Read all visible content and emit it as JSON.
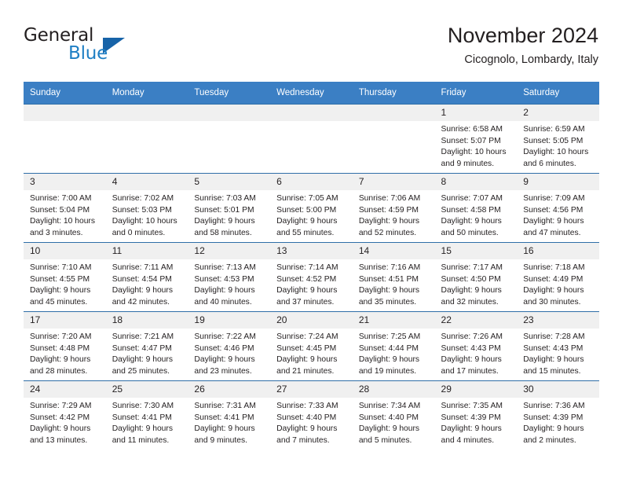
{
  "brand": {
    "name_part1": "General",
    "name_part2": "Blue",
    "triangle_color": "#1763a8",
    "blue_color": "#1f7fc4"
  },
  "header": {
    "month_title": "November 2024",
    "location": "Cicognolo, Lombardy, Italy"
  },
  "theme": {
    "header_bg": "#3b7fc4",
    "daynum_bg": "#f0f0f0",
    "row_border": "#2f6ea8",
    "text": "#231f20"
  },
  "calendar": {
    "weekday_headers": [
      "Sunday",
      "Monday",
      "Tuesday",
      "Wednesday",
      "Thursday",
      "Friday",
      "Saturday"
    ],
    "labels": {
      "sunrise": "Sunrise:",
      "sunset": "Sunset:",
      "daylight": "Daylight:"
    },
    "weeks": [
      [
        {
          "day": "",
          "blank": true
        },
        {
          "day": "",
          "blank": true
        },
        {
          "day": "",
          "blank": true
        },
        {
          "day": "",
          "blank": true
        },
        {
          "day": "",
          "blank": true
        },
        {
          "day": "1",
          "sunrise": "Sunrise: 6:58 AM",
          "sunset": "Sunset: 5:07 PM",
          "daylight_l1": "Daylight: 10 hours",
          "daylight_l2": "and 9 minutes."
        },
        {
          "day": "2",
          "sunrise": "Sunrise: 6:59 AM",
          "sunset": "Sunset: 5:05 PM",
          "daylight_l1": "Daylight: 10 hours",
          "daylight_l2": "and 6 minutes."
        }
      ],
      [
        {
          "day": "3",
          "sunrise": "Sunrise: 7:00 AM",
          "sunset": "Sunset: 5:04 PM",
          "daylight_l1": "Daylight: 10 hours",
          "daylight_l2": "and 3 minutes."
        },
        {
          "day": "4",
          "sunrise": "Sunrise: 7:02 AM",
          "sunset": "Sunset: 5:03 PM",
          "daylight_l1": "Daylight: 10 hours",
          "daylight_l2": "and 0 minutes."
        },
        {
          "day": "5",
          "sunrise": "Sunrise: 7:03 AM",
          "sunset": "Sunset: 5:01 PM",
          "daylight_l1": "Daylight: 9 hours",
          "daylight_l2": "and 58 minutes."
        },
        {
          "day": "6",
          "sunrise": "Sunrise: 7:05 AM",
          "sunset": "Sunset: 5:00 PM",
          "daylight_l1": "Daylight: 9 hours",
          "daylight_l2": "and 55 minutes."
        },
        {
          "day": "7",
          "sunrise": "Sunrise: 7:06 AM",
          "sunset": "Sunset: 4:59 PM",
          "daylight_l1": "Daylight: 9 hours",
          "daylight_l2": "and 52 minutes."
        },
        {
          "day": "8",
          "sunrise": "Sunrise: 7:07 AM",
          "sunset": "Sunset: 4:58 PM",
          "daylight_l1": "Daylight: 9 hours",
          "daylight_l2": "and 50 minutes."
        },
        {
          "day": "9",
          "sunrise": "Sunrise: 7:09 AM",
          "sunset": "Sunset: 4:56 PM",
          "daylight_l1": "Daylight: 9 hours",
          "daylight_l2": "and 47 minutes."
        }
      ],
      [
        {
          "day": "10",
          "sunrise": "Sunrise: 7:10 AM",
          "sunset": "Sunset: 4:55 PM",
          "daylight_l1": "Daylight: 9 hours",
          "daylight_l2": "and 45 minutes."
        },
        {
          "day": "11",
          "sunrise": "Sunrise: 7:11 AM",
          "sunset": "Sunset: 4:54 PM",
          "daylight_l1": "Daylight: 9 hours",
          "daylight_l2": "and 42 minutes."
        },
        {
          "day": "12",
          "sunrise": "Sunrise: 7:13 AM",
          "sunset": "Sunset: 4:53 PM",
          "daylight_l1": "Daylight: 9 hours",
          "daylight_l2": "and 40 minutes."
        },
        {
          "day": "13",
          "sunrise": "Sunrise: 7:14 AM",
          "sunset": "Sunset: 4:52 PM",
          "daylight_l1": "Daylight: 9 hours",
          "daylight_l2": "and 37 minutes."
        },
        {
          "day": "14",
          "sunrise": "Sunrise: 7:16 AM",
          "sunset": "Sunset: 4:51 PM",
          "daylight_l1": "Daylight: 9 hours",
          "daylight_l2": "and 35 minutes."
        },
        {
          "day": "15",
          "sunrise": "Sunrise: 7:17 AM",
          "sunset": "Sunset: 4:50 PM",
          "daylight_l1": "Daylight: 9 hours",
          "daylight_l2": "and 32 minutes."
        },
        {
          "day": "16",
          "sunrise": "Sunrise: 7:18 AM",
          "sunset": "Sunset: 4:49 PM",
          "daylight_l1": "Daylight: 9 hours",
          "daylight_l2": "and 30 minutes."
        }
      ],
      [
        {
          "day": "17",
          "sunrise": "Sunrise: 7:20 AM",
          "sunset": "Sunset: 4:48 PM",
          "daylight_l1": "Daylight: 9 hours",
          "daylight_l2": "and 28 minutes."
        },
        {
          "day": "18",
          "sunrise": "Sunrise: 7:21 AM",
          "sunset": "Sunset: 4:47 PM",
          "daylight_l1": "Daylight: 9 hours",
          "daylight_l2": "and 25 minutes."
        },
        {
          "day": "19",
          "sunrise": "Sunrise: 7:22 AM",
          "sunset": "Sunset: 4:46 PM",
          "daylight_l1": "Daylight: 9 hours",
          "daylight_l2": "and 23 minutes."
        },
        {
          "day": "20",
          "sunrise": "Sunrise: 7:24 AM",
          "sunset": "Sunset: 4:45 PM",
          "daylight_l1": "Daylight: 9 hours",
          "daylight_l2": "and 21 minutes."
        },
        {
          "day": "21",
          "sunrise": "Sunrise: 7:25 AM",
          "sunset": "Sunset: 4:44 PM",
          "daylight_l1": "Daylight: 9 hours",
          "daylight_l2": "and 19 minutes."
        },
        {
          "day": "22",
          "sunrise": "Sunrise: 7:26 AM",
          "sunset": "Sunset: 4:43 PM",
          "daylight_l1": "Daylight: 9 hours",
          "daylight_l2": "and 17 minutes."
        },
        {
          "day": "23",
          "sunrise": "Sunrise: 7:28 AM",
          "sunset": "Sunset: 4:43 PM",
          "daylight_l1": "Daylight: 9 hours",
          "daylight_l2": "and 15 minutes."
        }
      ],
      [
        {
          "day": "24",
          "sunrise": "Sunrise: 7:29 AM",
          "sunset": "Sunset: 4:42 PM",
          "daylight_l1": "Daylight: 9 hours",
          "daylight_l2": "and 13 minutes."
        },
        {
          "day": "25",
          "sunrise": "Sunrise: 7:30 AM",
          "sunset": "Sunset: 4:41 PM",
          "daylight_l1": "Daylight: 9 hours",
          "daylight_l2": "and 11 minutes."
        },
        {
          "day": "26",
          "sunrise": "Sunrise: 7:31 AM",
          "sunset": "Sunset: 4:41 PM",
          "daylight_l1": "Daylight: 9 hours",
          "daylight_l2": "and 9 minutes."
        },
        {
          "day": "27",
          "sunrise": "Sunrise: 7:33 AM",
          "sunset": "Sunset: 4:40 PM",
          "daylight_l1": "Daylight: 9 hours",
          "daylight_l2": "and 7 minutes."
        },
        {
          "day": "28",
          "sunrise": "Sunrise: 7:34 AM",
          "sunset": "Sunset: 4:40 PM",
          "daylight_l1": "Daylight: 9 hours",
          "daylight_l2": "and 5 minutes."
        },
        {
          "day": "29",
          "sunrise": "Sunrise: 7:35 AM",
          "sunset": "Sunset: 4:39 PM",
          "daylight_l1": "Daylight: 9 hours",
          "daylight_l2": "and 4 minutes."
        },
        {
          "day": "30",
          "sunrise": "Sunrise: 7:36 AM",
          "sunset": "Sunset: 4:39 PM",
          "daylight_l1": "Daylight: 9 hours",
          "daylight_l2": "and 2 minutes."
        }
      ]
    ]
  }
}
